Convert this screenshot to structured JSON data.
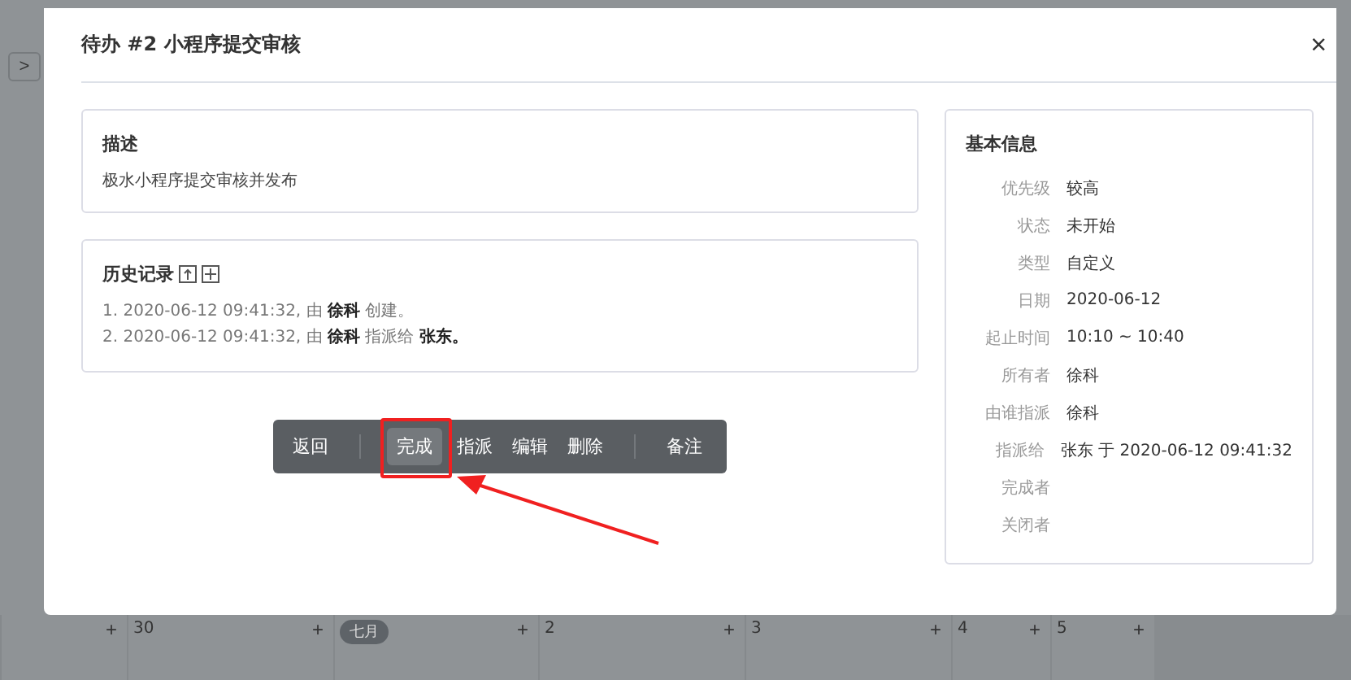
{
  "dialog": {
    "title": "待办 #2 小程序提交审核",
    "close": "×"
  },
  "description": {
    "heading": "描述",
    "text": "极水小程序提交审核并发布"
  },
  "history": {
    "heading": "历史记录",
    "entries": [
      "1. 2020-06-12 09:41:32, 由 **徐科** 创建。",
      "2. 2020-06-12 09:41:32, 由 **徐科** 指派给 **张东。**"
    ]
  },
  "toolbar": [
    {
      "kind": "button",
      "label": "返回",
      "selected": false
    },
    {
      "kind": "separator"
    },
    {
      "kind": "button",
      "label": "完成",
      "selected": true
    },
    {
      "kind": "button",
      "label": "指派",
      "selected": false
    },
    {
      "kind": "button",
      "label": "编辑",
      "selected": false
    },
    {
      "kind": "button",
      "label": "删除",
      "selected": false
    },
    {
      "kind": "separator"
    },
    {
      "kind": "button",
      "label": "备注",
      "selected": false
    }
  ],
  "basic_info": {
    "heading": "基本信息",
    "rows": [
      {
        "label": "优先级",
        "value": "较高"
      },
      {
        "label": "状态",
        "value": "未开始"
      },
      {
        "label": "类型",
        "value": "自定义"
      },
      {
        "label": "日期",
        "value": "2020-06-12"
      },
      {
        "label": "起止时间",
        "value": "10:10 ~ 10:40"
      },
      {
        "label": "所有者",
        "value": "徐科"
      },
      {
        "label": "由谁指派",
        "value": "徐科"
      },
      {
        "label": "指派给",
        "value": "张东 于 2020-06-12 09:41:32"
      },
      {
        "label": "完成者"
      },
      {
        "label": "关闭者"
      }
    ]
  },
  "calendar_row": [
    {
      "kind": "day",
      "add": "+"
    },
    {
      "kind": "day",
      "label": "30",
      "add": "+"
    },
    {
      "kind": "month",
      "label": "七月",
      "add": "+"
    },
    {
      "kind": "day",
      "label": "2",
      "add": "+"
    },
    {
      "kind": "day",
      "label": "3",
      "add": "+"
    },
    {
      "kind": "day",
      "label": "4",
      "add": "+"
    },
    {
      "kind": "day",
      "label": "5",
      "add": "+"
    }
  ],
  "side_nav": {
    "next": ">"
  }
}
